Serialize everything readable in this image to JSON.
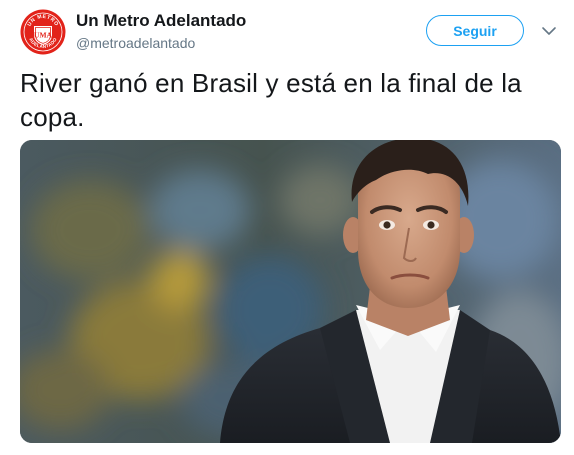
{
  "author": {
    "name": "Un Metro Adelantado",
    "handle": "@metroadelantado",
    "avatar_text_top": "UN METRO",
    "avatar_text_center": "UMA",
    "avatar_text_bottom": "ADELANTADO",
    "avatar_color": "#e2231a"
  },
  "actions": {
    "follow_label": "Seguir",
    "menu_icon": "chevron-down-icon"
  },
  "tweet": {
    "text": "River ganó en Brasil y está en la final de la copa."
  },
  "colors": {
    "accent": "#1da1f2",
    "text": "#14171a",
    "secondary_text": "#657786"
  }
}
